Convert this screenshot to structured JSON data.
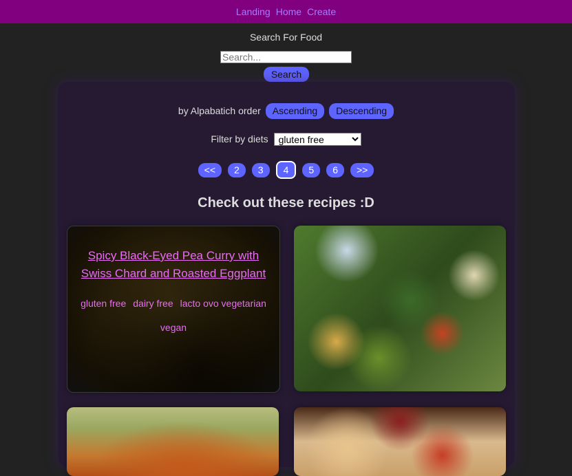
{
  "nav": {
    "links": [
      "Landing",
      "Home",
      "Create"
    ]
  },
  "search": {
    "label": "Search For Food",
    "placeholder": "Search...",
    "button_label": "Search"
  },
  "sort": {
    "label": "by Alpabatich order",
    "ascending_label": "Ascending",
    "descending_label": "Descending"
  },
  "filter": {
    "label": "Filter by diets",
    "selected": "gluten free"
  },
  "pagination": {
    "prev_label": "<<",
    "pages": [
      "2",
      "3",
      "4",
      "5",
      "6"
    ],
    "current_page": "4",
    "next_label": ">>"
  },
  "heading": "Check out these recipes :D",
  "recipes": [
    {
      "title": "Spicy Black-Eyed Pea Curry with Swiss Chard and Roasted Eggplant",
      "diets": [
        "gluten free",
        "dairy free",
        "lacto ovo vegetarian",
        "vegan"
      ]
    }
  ],
  "colors": {
    "nav_bg": "#800080",
    "nav_link": "#a67cff",
    "button_bg": "#5e64ff",
    "page_bg": "#222222",
    "panel_bg": "#261a33",
    "recipe_text": "#e86cf5"
  }
}
